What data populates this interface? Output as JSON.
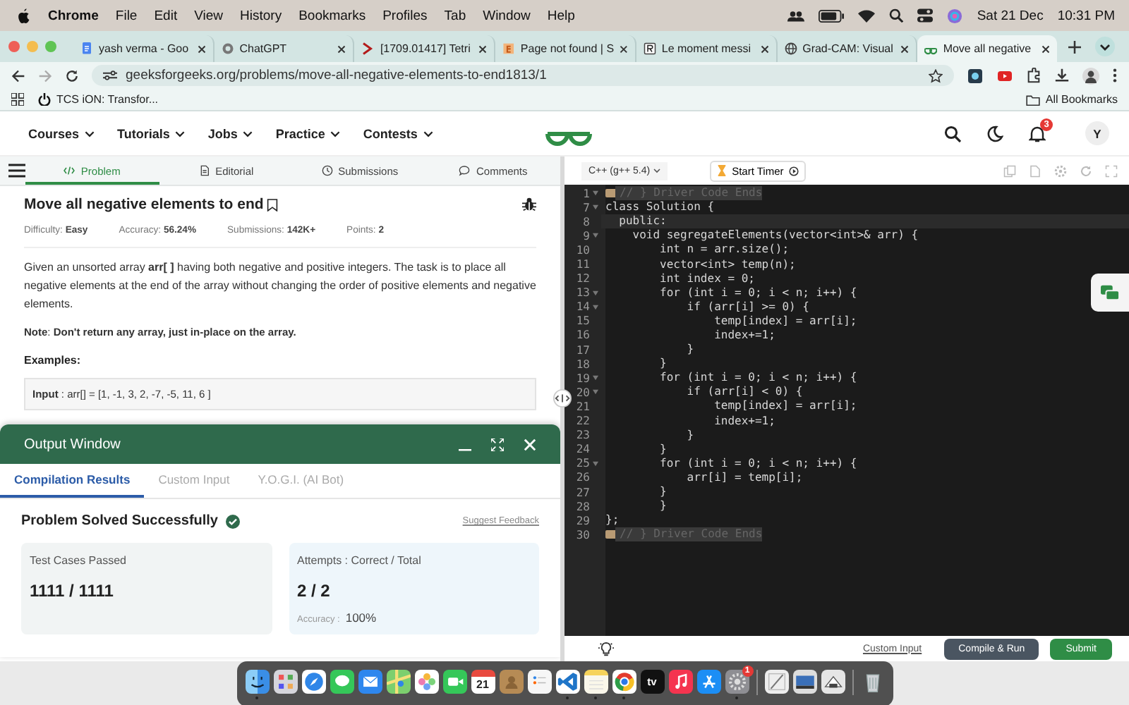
{
  "menubar": {
    "app": "Chrome",
    "menus": [
      "File",
      "Edit",
      "View",
      "History",
      "Bookmarks",
      "Profiles",
      "Tab",
      "Window",
      "Help"
    ],
    "date": "Sat 21 Dec",
    "time": "10:31 PM"
  },
  "browser": {
    "tabs": [
      {
        "title": "yash verma - Goo",
        "kind": "doc",
        "selected": false
      },
      {
        "title": "ChatGPT",
        "kind": "chat",
        "selected": false
      },
      {
        "title": "[1709.01417] Tetri",
        "kind": "arxiv",
        "selected": false
      },
      {
        "title": "Page not found | S",
        "kind": "letter",
        "selected": false
      },
      {
        "title": "Le moment messi",
        "kind": "square",
        "selected": false
      },
      {
        "title": "Grad-CAM: Visual",
        "kind": "globe",
        "selected": false
      },
      {
        "title": "Move all negative",
        "kind": "site",
        "selected": true
      }
    ],
    "url": "geeksforgeeks.org/problems/move-all-negative-elements-to-end1813/1",
    "bookmarks": [
      "TCS iON: Transfor..."
    ],
    "all_bookmarks": "All Bookmarks"
  },
  "site_nav": {
    "menus": [
      "Courses",
      "Tutorials",
      "Jobs",
      "Practice",
      "Contests"
    ],
    "notification_count": "3",
    "avatar": "Y"
  },
  "problem": {
    "tabs": [
      {
        "label": "Problem",
        "kind": "code",
        "selected": true
      },
      {
        "label": "Editorial",
        "kind": "doc",
        "selected": false
      },
      {
        "label": "Submissions",
        "kind": "clock",
        "selected": false
      },
      {
        "label": "Comments",
        "kind": "comment",
        "selected": false
      }
    ],
    "title": "Move all negative elements to end",
    "meta": [
      "Difficulty: **Easy**",
      "Accuracy: **56.24%**",
      "Submissions: **142K+**",
      "Points: **2**"
    ],
    "description": "Given an unsorted array **arr[ ]** having both negative and positive integers. The task is to place all negative elements at the end of the array without changing the order of positive elements and negative elements.",
    "note": "**Note**: **Don't return any array, just in-place on the array.**",
    "examples_heading": "Examples:",
    "example_input": "**Input** : arr[] = [1, -1, 3, 2, -7, -5, 11, 6 ]"
  },
  "output_window": {
    "title": "Output Window",
    "tabs": [
      {
        "label": "Compilation Results",
        "selected": true
      },
      {
        "label": "Custom Input",
        "selected": false
      },
      {
        "label": "Y.O.G.I. (AI Bot)",
        "selected": false
      }
    ],
    "status": "Problem Solved Successfully",
    "feedback": "Suggest Feedback",
    "cards": [
      {
        "label": "Test Cases Passed",
        "value": "1111 / 1111"
      },
      {
        "label": "Attempts : Correct / Total",
        "value": "2 / 2",
        "sub_label": "Accuracy :",
        "sub_value": "100%"
      }
    ]
  },
  "editor": {
    "language": "C++ (g++ 5.4)",
    "timer": "Start Timer",
    "lines": [
      {
        "num": "1",
        "kind": "comment",
        "foldable": true,
        "active": false,
        "text": "// } Driver Code Ends"
      },
      {
        "num": "7",
        "kind": "code",
        "foldable": true,
        "active": false,
        "text": "class Solution {"
      },
      {
        "num": "8",
        "kind": "code",
        "foldable": false,
        "active": true,
        "text": "  public:"
      },
      {
        "num": "9",
        "kind": "code",
        "foldable": true,
        "active": false,
        "text": "    void segregateElements(vector<int>& arr) {"
      },
      {
        "num": "10",
        "kind": "code",
        "foldable": false,
        "active": false,
        "text": "        int n = arr.size();"
      },
      {
        "num": "11",
        "kind": "code",
        "foldable": false,
        "active": false,
        "text": "        vector<int> temp(n);"
      },
      {
        "num": "12",
        "kind": "code",
        "foldable": false,
        "active": false,
        "text": "        int index = 0;"
      },
      {
        "num": "13",
        "kind": "code",
        "foldable": true,
        "active": false,
        "text": "        for (int i = 0; i < n; i++) {"
      },
      {
        "num": "14",
        "kind": "code",
        "foldable": true,
        "active": false,
        "text": "            if (arr[i] >= 0) {"
      },
      {
        "num": "15",
        "kind": "code",
        "foldable": false,
        "active": false,
        "text": "                temp[index] = arr[i];"
      },
      {
        "num": "16",
        "kind": "code",
        "foldable": false,
        "active": false,
        "text": "                index+=1;"
      },
      {
        "num": "17",
        "kind": "code",
        "foldable": false,
        "active": false,
        "text": "            }"
      },
      {
        "num": "18",
        "kind": "code",
        "foldable": false,
        "active": false,
        "text": "        }"
      },
      {
        "num": "19",
        "kind": "code",
        "foldable": true,
        "active": false,
        "text": "        for (int i = 0; i < n; i++) {"
      },
      {
        "num": "20",
        "kind": "code",
        "foldable": true,
        "active": false,
        "text": "            if (arr[i] < 0) {"
      },
      {
        "num": "21",
        "kind": "code",
        "foldable": false,
        "active": false,
        "text": "                temp[index] = arr[i];"
      },
      {
        "num": "22",
        "kind": "code",
        "foldable": false,
        "active": false,
        "text": "                index+=1;"
      },
      {
        "num": "23",
        "kind": "code",
        "foldable": false,
        "active": false,
        "text": "            }"
      },
      {
        "num": "24",
        "kind": "code",
        "foldable": false,
        "active": false,
        "text": "        }"
      },
      {
        "num": "25",
        "kind": "code",
        "foldable": true,
        "active": false,
        "text": "        for (int i = 0; i < n; i++) {"
      },
      {
        "num": "26",
        "kind": "code",
        "foldable": false,
        "active": false,
        "text": "            arr[i] = temp[i];"
      },
      {
        "num": "27",
        "kind": "code",
        "foldable": false,
        "active": false,
        "text": "        }"
      },
      {
        "num": "28",
        "kind": "code",
        "foldable": false,
        "active": false,
        "text": "        }"
      },
      {
        "num": "29",
        "kind": "code",
        "foldable": false,
        "active": false,
        "text": "};"
      },
      {
        "num": "30",
        "kind": "comment",
        "foldable": false,
        "active": false,
        "text": "// } Driver Code Ends"
      }
    ],
    "custom_input": "Custom Input",
    "compile": "Compile & Run",
    "submit": "Submit"
  },
  "dock": [
    {
      "kind": "finder",
      "running": true
    },
    {
      "kind": "launchpad",
      "running": false
    },
    {
      "kind": "safari",
      "running": false
    },
    {
      "kind": "messages",
      "running": false
    },
    {
      "kind": "mail",
      "running": false
    },
    {
      "kind": "maps",
      "running": false
    },
    {
      "kind": "photos",
      "running": false
    },
    {
      "kind": "facetime",
      "running": false
    },
    {
      "kind": "calendar",
      "label": "21",
      "running": false
    },
    {
      "kind": "contacts",
      "running": false
    },
    {
      "kind": "reminders",
      "running": false
    },
    {
      "kind": "vscode",
      "running": true
    },
    {
      "kind": "notes",
      "running": true
    },
    {
      "kind": "chrome",
      "running": true
    },
    {
      "kind": "tv",
      "label": "tv",
      "running": false
    },
    {
      "kind": "music",
      "running": false
    },
    {
      "kind": "appstore",
      "running": false
    },
    {
      "kind": "settings",
      "badge": "1",
      "running": true
    },
    {
      "kind": "separator"
    },
    {
      "kind": "preview",
      "running": false
    },
    {
      "kind": "screenshot",
      "running": false
    },
    {
      "kind": "gallery",
      "running": false
    },
    {
      "kind": "separator"
    },
    {
      "kind": "trash",
      "running": false
    }
  ]
}
